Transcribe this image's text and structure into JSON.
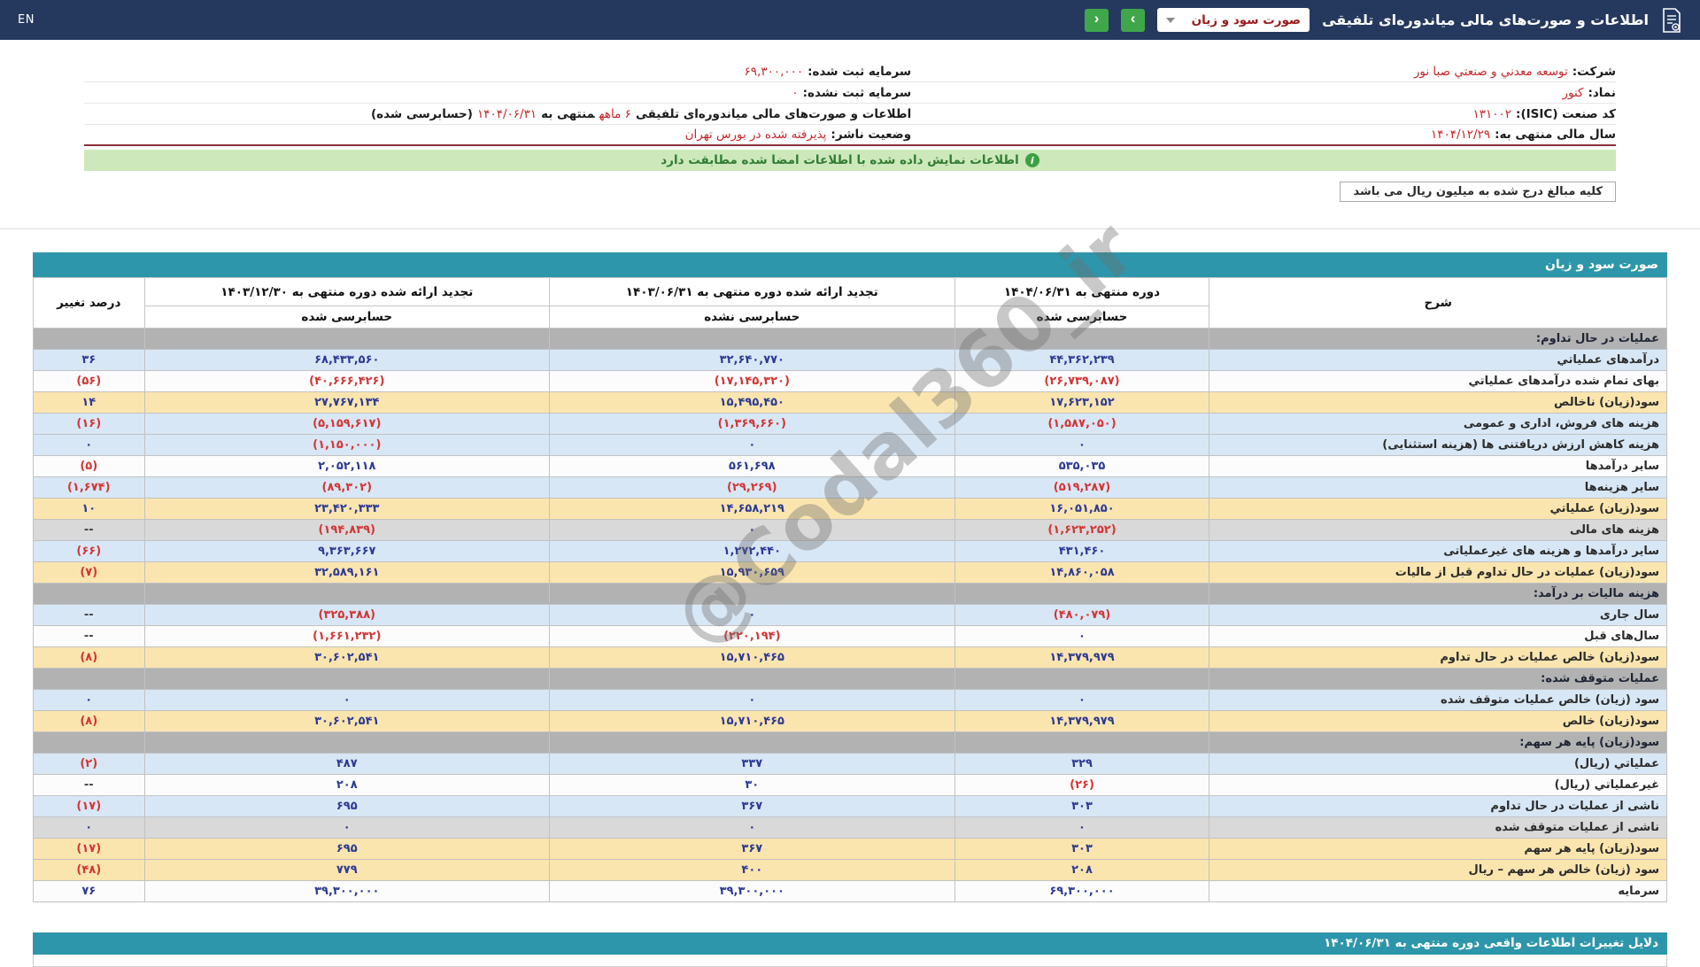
{
  "topbar": {
    "lang": "EN",
    "title": "اطلاعات و صورت‌های مالی میاندوره‌ای تلفیقی",
    "report_dropdown": "صورت سود و زیان",
    "nav_next": "›",
    "nav_prev": "‹"
  },
  "company": {
    "rows": [
      {
        "right": [
          {
            "t": "شرکت:",
            "k": "label"
          },
          {
            "t": "توسعه معدني و صنعتي صبا نور",
            "k": "value"
          }
        ],
        "left": [
          {
            "t": "سرمایه ثبت شده:",
            "k": "label"
          },
          {
            "t": "۶۹,۳۰۰,۰۰۰",
            "k": "value"
          }
        ]
      },
      {
        "right": [
          {
            "t": "نماد:",
            "k": "label"
          },
          {
            "t": "کنور",
            "k": "value"
          }
        ],
        "left": [
          {
            "t": "سرمایه ثبت نشده:",
            "k": "label"
          },
          {
            "t": "۰",
            "k": "value"
          }
        ]
      },
      {
        "right": [
          {
            "t": "کد صنعت (ISIC):",
            "k": "label"
          },
          {
            "t": "۱۳۱۰۰۲",
            "k": "value"
          }
        ],
        "left": [
          {
            "t": "اطلاعات و صورت‌های مالی میاندوره‌ای تلفیقی",
            "k": "label"
          },
          {
            "t": "۶ ماهه",
            "k": "value"
          },
          {
            "t": "منتهی به",
            "k": "label"
          },
          {
            "t": "۱۴۰۴/۰۶/۳۱",
            "k": "value"
          },
          {
            "t": "(حسابرسی شده)",
            "k": "label"
          }
        ]
      },
      {
        "right": [
          {
            "t": "سال مالی منتهی به:",
            "k": "label"
          },
          {
            "t": "۱۴۰۴/۱۲/۲۹",
            "k": "value"
          }
        ],
        "left": [
          {
            "t": "وضعیت ناشر:",
            "k": "label"
          },
          {
            "t": "پذیرفته شده در بورس تهران",
            "k": "value"
          }
        ]
      }
    ]
  },
  "banner": {
    "text": "اطلاعات نمایش داده شده با اطلاعات امضا شده مطابقت دارد",
    "icon": "i"
  },
  "note": "کلیه مبالغ درج شده به میلیون ریال می باشد",
  "table": {
    "title": "صورت سود و زیان",
    "headers": {
      "desc": "شرح",
      "pct": "درصد تغییر",
      "periods": [
        {
          "title": "دوره منتهی به ۱۴۰۴/۰۶/۳۱",
          "sub": "حسابرسی شده"
        },
        {
          "title": "تجدید ارائه شده دوره منتهی به ۱۴۰۳/۰۶/۳۱",
          "sub": "حسابرسی نشده"
        },
        {
          "title": "تجدید ارائه شده دوره منتهی به ۱۴۰۳/۱۲/۳۰",
          "sub": "حسابرسی شده"
        }
      ]
    },
    "rows": [
      {
        "label": "عملیات در حال تداوم:",
        "bg": "section"
      },
      {
        "label": "درآمدهای عملیاتي",
        "v1": "۴۴,۳۶۲,۲۳۹",
        "v2": "۳۲,۶۴۰,۷۷۰",
        "v3": "۶۸,۴۳۳,۵۶۰",
        "pct": "۳۶",
        "bg": "blue"
      },
      {
        "label": "بهای تمام شده درآمدهای عملیاتي",
        "v1": "(۲۶,۷۳۹,۰۸۷)",
        "v2": "(۱۷,۱۴۵,۳۲۰)",
        "v3": "(۴۰,۶۶۶,۴۲۶)",
        "pct": "(۵۶)",
        "bg": "plain"
      },
      {
        "label": "سود(زیان) ناخالص",
        "v1": "۱۷,۶۲۳,۱۵۲",
        "v2": "۱۵,۴۹۵,۴۵۰",
        "v3": "۲۷,۷۶۷,۱۳۴",
        "pct": "۱۴",
        "bg": "yellow"
      },
      {
        "label": "هزینه های فروش، اداری و عمومی",
        "v1": "(۱,۵۸۷,۰۵۰)",
        "v2": "(۱,۳۶۹,۶۶۰)",
        "v3": "(۵,۱۵۹,۶۱۷)",
        "pct": "(۱۶)",
        "bg": "blue"
      },
      {
        "label": "هزینه کاهش ارزش دریافتنی ها (هزینه استثنایی)",
        "v1": "۰",
        "v2": "۰",
        "v3": "(۱,۱۵۰,۰۰۰)",
        "pct": "۰",
        "bg": "blue"
      },
      {
        "label": "سایر درآمدها",
        "v1": "۵۳۵,۰۳۵",
        "v2": "۵۶۱,۶۹۸",
        "v3": "۲,۰۵۲,۱۱۸",
        "pct": "(۵)",
        "bg": "plain"
      },
      {
        "label": "سایر هزینه‌ها",
        "v1": "(۵۱۹,۲۸۷)",
        "v2": "(۲۹,۲۶۹)",
        "v3": "(۸۹,۳۰۲)",
        "pct": "(۱,۶۷۴)",
        "bg": "blue"
      },
      {
        "label": "سود(زیان) عملیاتي",
        "v1": "۱۶,۰۵۱,۸۵۰",
        "v2": "۱۴,۶۵۸,۲۱۹",
        "v3": "۲۳,۴۲۰,۳۳۳",
        "pct": "۱۰",
        "bg": "yellow"
      },
      {
        "label": "هزینه های مالی",
        "v1": "(۱,۶۲۳,۲۵۲)",
        "v2": "۰",
        "v3": "(۱۹۴,۸۳۹)",
        "pct": "--",
        "bg": "gray"
      },
      {
        "label": "سایر درآمدها و هزینه های غیرعملیاتی",
        "v1": "۴۳۱,۴۶۰",
        "v2": "۱,۲۷۲,۴۴۰",
        "v3": "۹,۳۶۳,۶۶۷",
        "pct": "(۶۶)",
        "bg": "blue"
      },
      {
        "label": "سود(زیان) عملیات در حال تداوم قبل از مالیات",
        "v1": "۱۴,۸۶۰,۰۵۸",
        "v2": "۱۵,۹۳۰,۶۵۹",
        "v3": "۳۲,۵۸۹,۱۶۱",
        "pct": "(۷)",
        "bg": "yellow"
      },
      {
        "label": "هزینه مالیات بر درآمد:",
        "bg": "section"
      },
      {
        "label": "سال جاری",
        "v1": "(۴۸۰,۰۷۹)",
        "v2": "۰",
        "v3": "(۳۲۵,۳۸۸)",
        "pct": "--",
        "bg": "blue"
      },
      {
        "label": "سال‌های قبل",
        "v1": "۰",
        "v2": "(۲۲۰,۱۹۴)",
        "v3": "(۱,۶۶۱,۲۳۲)",
        "pct": "--",
        "bg": "plain"
      },
      {
        "label": "سود(زیان) خالص عملیات در حال تداوم",
        "v1": "۱۴,۳۷۹,۹۷۹",
        "v2": "۱۵,۷۱۰,۴۶۵",
        "v3": "۳۰,۶۰۲,۵۴۱",
        "pct": "(۸)",
        "bg": "yellow"
      },
      {
        "label": "عملیات متوقف شده:",
        "bg": "section"
      },
      {
        "label": "سود (زیان) خالص عملیات متوقف شده",
        "v1": "۰",
        "v2": "۰",
        "v3": "۰",
        "pct": "۰",
        "bg": "blue"
      },
      {
        "label": "سود(زیان) خالص",
        "v1": "۱۴,۳۷۹,۹۷۹",
        "v2": "۱۵,۷۱۰,۴۶۵",
        "v3": "۳۰,۶۰۲,۵۴۱",
        "pct": "(۸)",
        "bg": "yellow"
      },
      {
        "label": "سود(زیان) پایه هر سهم:",
        "bg": "section"
      },
      {
        "label": "عملیاتي (ریال)",
        "v1": "۳۲۹",
        "v2": "۳۳۷",
        "v3": "۴۸۷",
        "pct": "(۲)",
        "bg": "blue"
      },
      {
        "label": "غیرعملیاتي (ریال)",
        "v1": "(۲۶)",
        "v2": "۳۰",
        "v3": "۲۰۸",
        "pct": "--",
        "bg": "plain"
      },
      {
        "label": "ناشی از عملیات در حال تداوم",
        "v1": "۳۰۳",
        "v2": "۳۶۷",
        "v3": "۶۹۵",
        "pct": "(۱۷)",
        "bg": "blue"
      },
      {
        "label": "ناشی از عملیات متوقف شده",
        "v1": "۰",
        "v2": "۰",
        "v3": "۰",
        "pct": "۰",
        "bg": "gray"
      },
      {
        "label": "سود(زیان) پایه هر سهم",
        "v1": "۳۰۳",
        "v2": "۳۶۷",
        "v3": "۶۹۵",
        "pct": "(۱۷)",
        "bg": "yellow"
      },
      {
        "label": "سود (زیان) خالص هر سهم – ریال",
        "v1": "۲۰۸",
        "v2": "۴۰۰",
        "v3": "۷۷۹",
        "pct": "(۴۸)",
        "bg": "yellow"
      },
      {
        "label": "سرمایه",
        "v1": "۶۹,۳۰۰,۰۰۰",
        "v2": "۳۹,۳۰۰,۰۰۰",
        "v3": "۳۹,۳۰۰,۰۰۰",
        "pct": "۷۶",
        "bg": "plain"
      }
    ]
  },
  "footer": {
    "title": "دلایل تغییرات اطلاعات واقعی دوره منتهی به ۱۴۰۴/۰۶/۳۱"
  },
  "watermark": "@Codal360_ir",
  "colors": {
    "navbar": "#25395f",
    "table_header": "#2e96aa",
    "nav_button": "#3fa74a",
    "positive_value": "#2c3a94",
    "negative_value": "#d33535",
    "row_blue": "#d8e7f5",
    "row_yellow": "#fbe5ae",
    "section_gray": "#b2b2b2"
  }
}
